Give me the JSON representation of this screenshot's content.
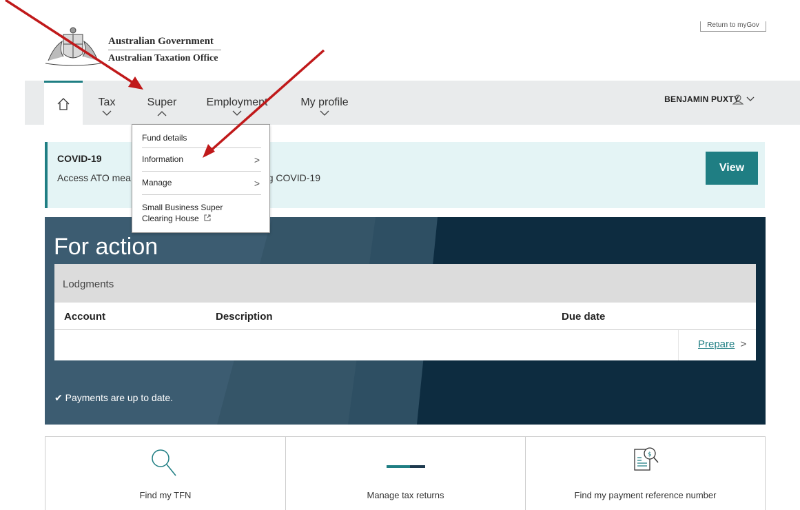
{
  "header": {
    "line1": "Australian Government",
    "line2": "Australian Taxation Office",
    "return_label": "Return to myGov"
  },
  "nav": {
    "items": [
      {
        "label": "Tax"
      },
      {
        "label": "Super"
      },
      {
        "label": "Employment"
      },
      {
        "label": "My profile"
      }
    ],
    "user": "BENJAMIN PUXTY",
    "accent": "#1f7e83"
  },
  "super_menu": {
    "items": [
      {
        "label": "Fund details"
      },
      {
        "label": "Information",
        "arrow": ">"
      },
      {
        "label": "Manage",
        "arrow": ">"
      },
      {
        "label": "Small Business Super Clearing House"
      }
    ]
  },
  "covid": {
    "title": "COVID-19",
    "text_left": "Access ATO mea",
    "text_right": "ing COVID-19",
    "button": "View"
  },
  "action": {
    "title": "For action",
    "section": "Lodgments",
    "columns": [
      "Account",
      "Description",
      "Due date"
    ],
    "prepare": "Prepare",
    "prepare_arrow": ">",
    "payments": "Payments are up to date."
  },
  "tiles": [
    {
      "label": "Find my TFN",
      "icon": "search-icon"
    },
    {
      "label": "Manage tax returns",
      "icon": "progress-bar-icon"
    },
    {
      "label": "Find my payment reference number",
      "icon": "document-search-icon"
    }
  ],
  "colors": {
    "teal": "#1f7e83",
    "navy": "#0d2c40",
    "annotation_arrow": "#c0191a"
  }
}
